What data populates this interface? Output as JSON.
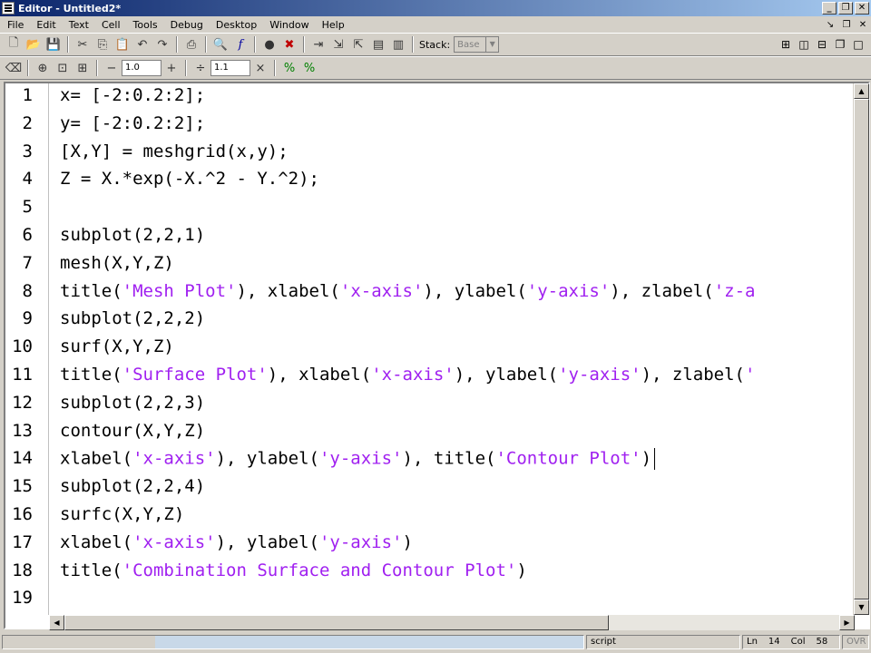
{
  "window": {
    "title": "Editor - Untitled2*"
  },
  "menu": [
    "File",
    "Edit",
    "Text",
    "Cell",
    "Tools",
    "Debug",
    "Desktop",
    "Window",
    "Help"
  ],
  "toolbar": {
    "stack_label": "Stack:",
    "stack_value": "Base",
    "decrement_label": "−",
    "increment_label": "+",
    "divide_label": "÷",
    "multiply_label": "×",
    "cell_step_value": "1.0",
    "cell_divisor_value": "1.1"
  },
  "editor": {
    "line_numbers": [
      "1",
      "2",
      "3",
      "4",
      "5",
      "6",
      "7",
      "8",
      "9",
      "10",
      "11",
      "12",
      "13",
      "14",
      "15",
      "16",
      "17",
      "18",
      "19"
    ],
    "lines": [
      [
        {
          "t": "x= [-2:0.2:2];"
        }
      ],
      [
        {
          "t": "y= [-2:0.2:2];"
        }
      ],
      [
        {
          "t": "[X,Y] = meshgrid(x,y);"
        }
      ],
      [
        {
          "t": "Z = X.*exp(-X.^2 - Y.^2);"
        }
      ],
      [
        {
          "t": ""
        }
      ],
      [
        {
          "t": "subplot(2,2,1)"
        }
      ],
      [
        {
          "t": "mesh(X,Y,Z)"
        }
      ],
      [
        {
          "t": "title("
        },
        {
          "t": "'Mesh Plot'",
          "s": 1
        },
        {
          "t": "), xlabel("
        },
        {
          "t": "'x-axis'",
          "s": 1
        },
        {
          "t": "), ylabel("
        },
        {
          "t": "'y-axis'",
          "s": 1
        },
        {
          "t": "), zlabel("
        },
        {
          "t": "'z-a",
          "s": 1
        }
      ],
      [
        {
          "t": "subplot(2,2,2)"
        }
      ],
      [
        {
          "t": "surf(X,Y,Z)"
        }
      ],
      [
        {
          "t": "title("
        },
        {
          "t": "'Surface Plot'",
          "s": 1
        },
        {
          "t": "), xlabel("
        },
        {
          "t": "'x-axis'",
          "s": 1
        },
        {
          "t": "), ylabel("
        },
        {
          "t": "'y-axis'",
          "s": 1
        },
        {
          "t": "), zlabel("
        },
        {
          "t": "'",
          "s": 1
        }
      ],
      [
        {
          "t": "subplot(2,2,3)"
        }
      ],
      [
        {
          "t": "contour(X,Y,Z)"
        }
      ],
      [
        {
          "t": "xlabel("
        },
        {
          "t": "'x-axis'",
          "s": 1
        },
        {
          "t": "), ylabel("
        },
        {
          "t": "'y-axis'",
          "s": 1
        },
        {
          "t": "), title("
        },
        {
          "t": "'Contour Plot'",
          "s": 1
        },
        {
          "t": ")"
        }
      ],
      [
        {
          "t": "subplot(2,2,4)"
        }
      ],
      [
        {
          "t": "surfc(X,Y,Z)"
        }
      ],
      [
        {
          "t": "xlabel("
        },
        {
          "t": "'x-axis'",
          "s": 1
        },
        {
          "t": "), ylabel("
        },
        {
          "t": "'y-axis'",
          "s": 1
        },
        {
          "t": ")"
        }
      ],
      [
        {
          "t": "title("
        },
        {
          "t": "'Combination Surface and Contour Plot'",
          "s": 1
        },
        {
          "t": ")"
        }
      ],
      [
        {
          "t": ""
        }
      ]
    ],
    "cursor_line": 14
  },
  "status": {
    "file_type": "script",
    "ln_label": "Ln",
    "ln_value": "14",
    "col_label": "Col",
    "col_value": "58",
    "ovr": "OVR"
  },
  "colors": {
    "string": "#a020f0",
    "title_bar": "#0a246a"
  }
}
